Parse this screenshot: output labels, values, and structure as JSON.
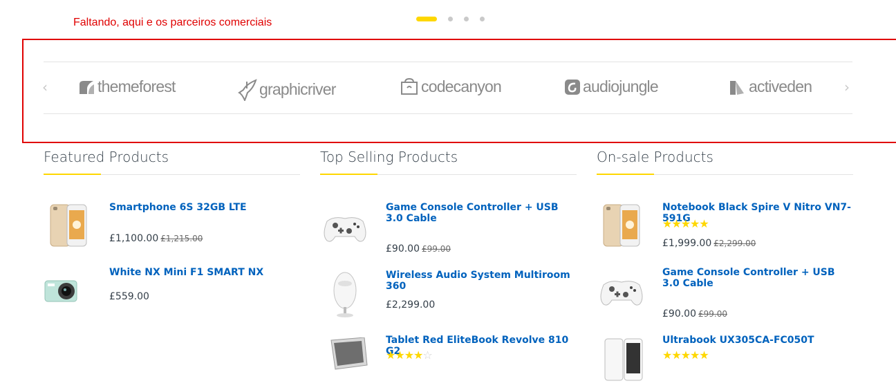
{
  "annotation": "Faltando, aqui e os parceiros comerciais",
  "carousel": {
    "slides": 4,
    "active": 1
  },
  "brands": {
    "prev_label": "‹",
    "next_label": "›",
    "items": [
      {
        "name": "themeforest",
        "icon": "leaf-icon"
      },
      {
        "name": "graphicriver",
        "icon": "pen-icon"
      },
      {
        "name": "codecanyon",
        "icon": "bag-icon"
      },
      {
        "name": "audiojungle",
        "icon": "swirl-icon"
      },
      {
        "name": "activeden",
        "icon": "fold-icon"
      }
    ]
  },
  "columns": [
    {
      "title": "Featured Products",
      "products": [
        {
          "name": "Smartphone 6S 32GB LTE",
          "price": "£1,100.00",
          "old_price": "£1,215.00",
          "image": "smartphone-gold"
        },
        {
          "name": "White NX Mini F1 SMART NX",
          "price": "£559.00",
          "old_price": "",
          "image": "camera-mint"
        }
      ]
    },
    {
      "title": "Top Selling Products",
      "products": [
        {
          "name": "Game Console Controller + USB 3.0 Cable",
          "price": "£90.00",
          "old_price": "£99.00",
          "image": "controller-white"
        },
        {
          "name": "Wireless Audio System Multiroom 360",
          "price": "£2,299.00",
          "old_price": "",
          "image": "speaker-white"
        },
        {
          "name": "Tablet Red EliteBook Revolve 810 G2",
          "rating": 4,
          "image": "tablet-laptop"
        }
      ]
    },
    {
      "title": "On-sale Products",
      "products": [
        {
          "name": "Notebook Black Spire V Nitro VN7-591G",
          "rating": 5,
          "price": "£1,999.00",
          "old_price": "£2,299.00",
          "image": "smartphone-gold"
        },
        {
          "name": "Game Console Controller + USB 3.0 Cable",
          "price": "£90.00",
          "old_price": "£99.00",
          "image": "controller-white"
        },
        {
          "name": "Ultrabook UX305CA-FC050T",
          "rating": 5,
          "image": "phone-white"
        }
      ]
    }
  ],
  "colors": {
    "accent": "#fed700",
    "link": "#0062bd",
    "annotation": "#e00000"
  }
}
